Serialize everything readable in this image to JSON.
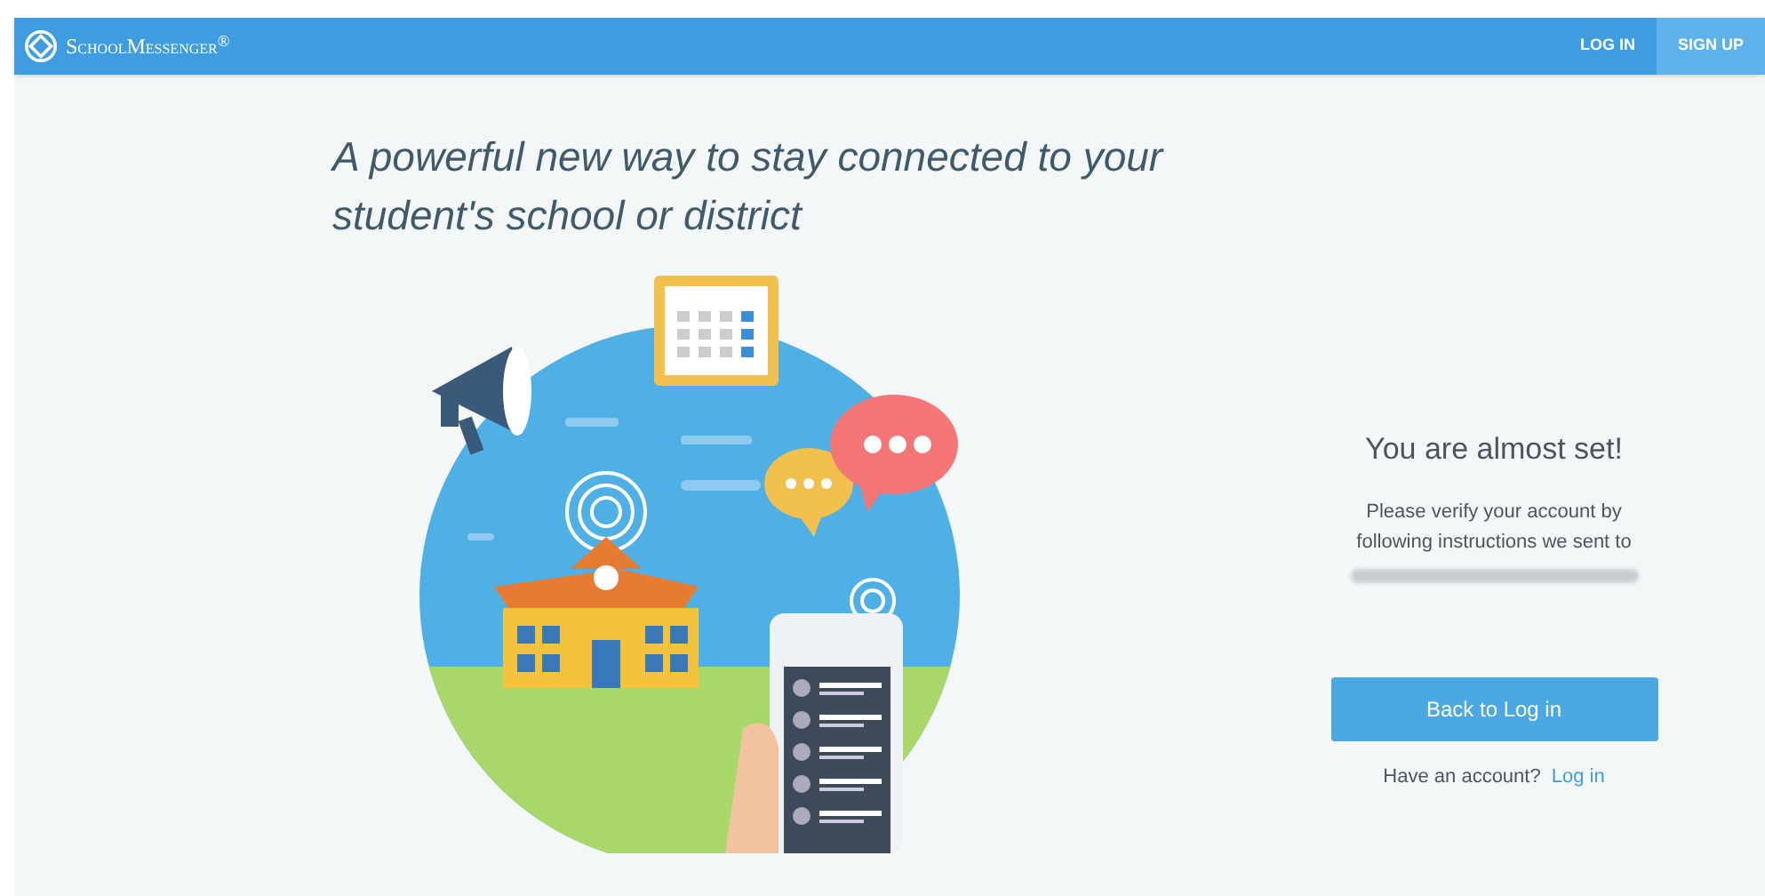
{
  "nav": {
    "logo": "SchoolMessenger$^{®}$",
    "items": [
      {
        "label": "LOG IN",
        "selected": false
      },
      {
        "label": "SIGN UP",
        "selected": true
      }
    ]
  },
  "headline": "A powerful new way to stay connected to your student's school or district",
  "panel": {
    "title": "You are almost set!",
    "message": "Please verify your account by following instructions we sent to",
    "email_blurred": true,
    "button": "Back to Log in",
    "prompt": "Have an account?",
    "link": "Log in"
  }
}
